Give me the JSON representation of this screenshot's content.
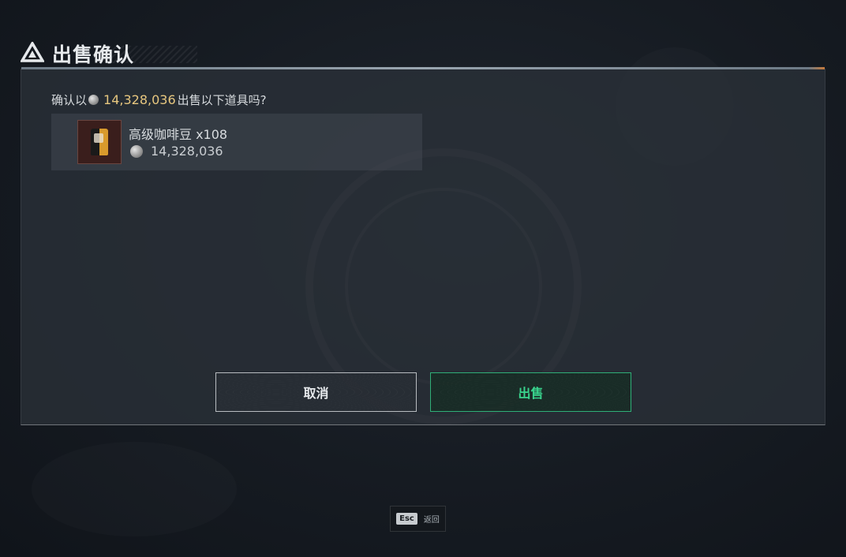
{
  "dialog": {
    "title": "出售确认",
    "title_icon": "triangle-logo-icon",
    "prompt_prefix": "确认以",
    "prompt_amount": "14,328,036",
    "prompt_suffix": "出售以下道具吗?",
    "currency_icon": "silver-coin-icon"
  },
  "item": {
    "name": "高级咖啡豆 x108",
    "price": "14,328,036",
    "thumbnail_icon": "coffee-bean-bag-icon"
  },
  "buttons": {
    "cancel_label": "取消",
    "sell_label": "出售"
  },
  "footer": {
    "esc_key": "Esc",
    "esc_label": "返回"
  },
  "colors": {
    "accent_green": "#39d48d",
    "amount_gold": "#e7c77f",
    "panel_bg": "#2a3138"
  }
}
